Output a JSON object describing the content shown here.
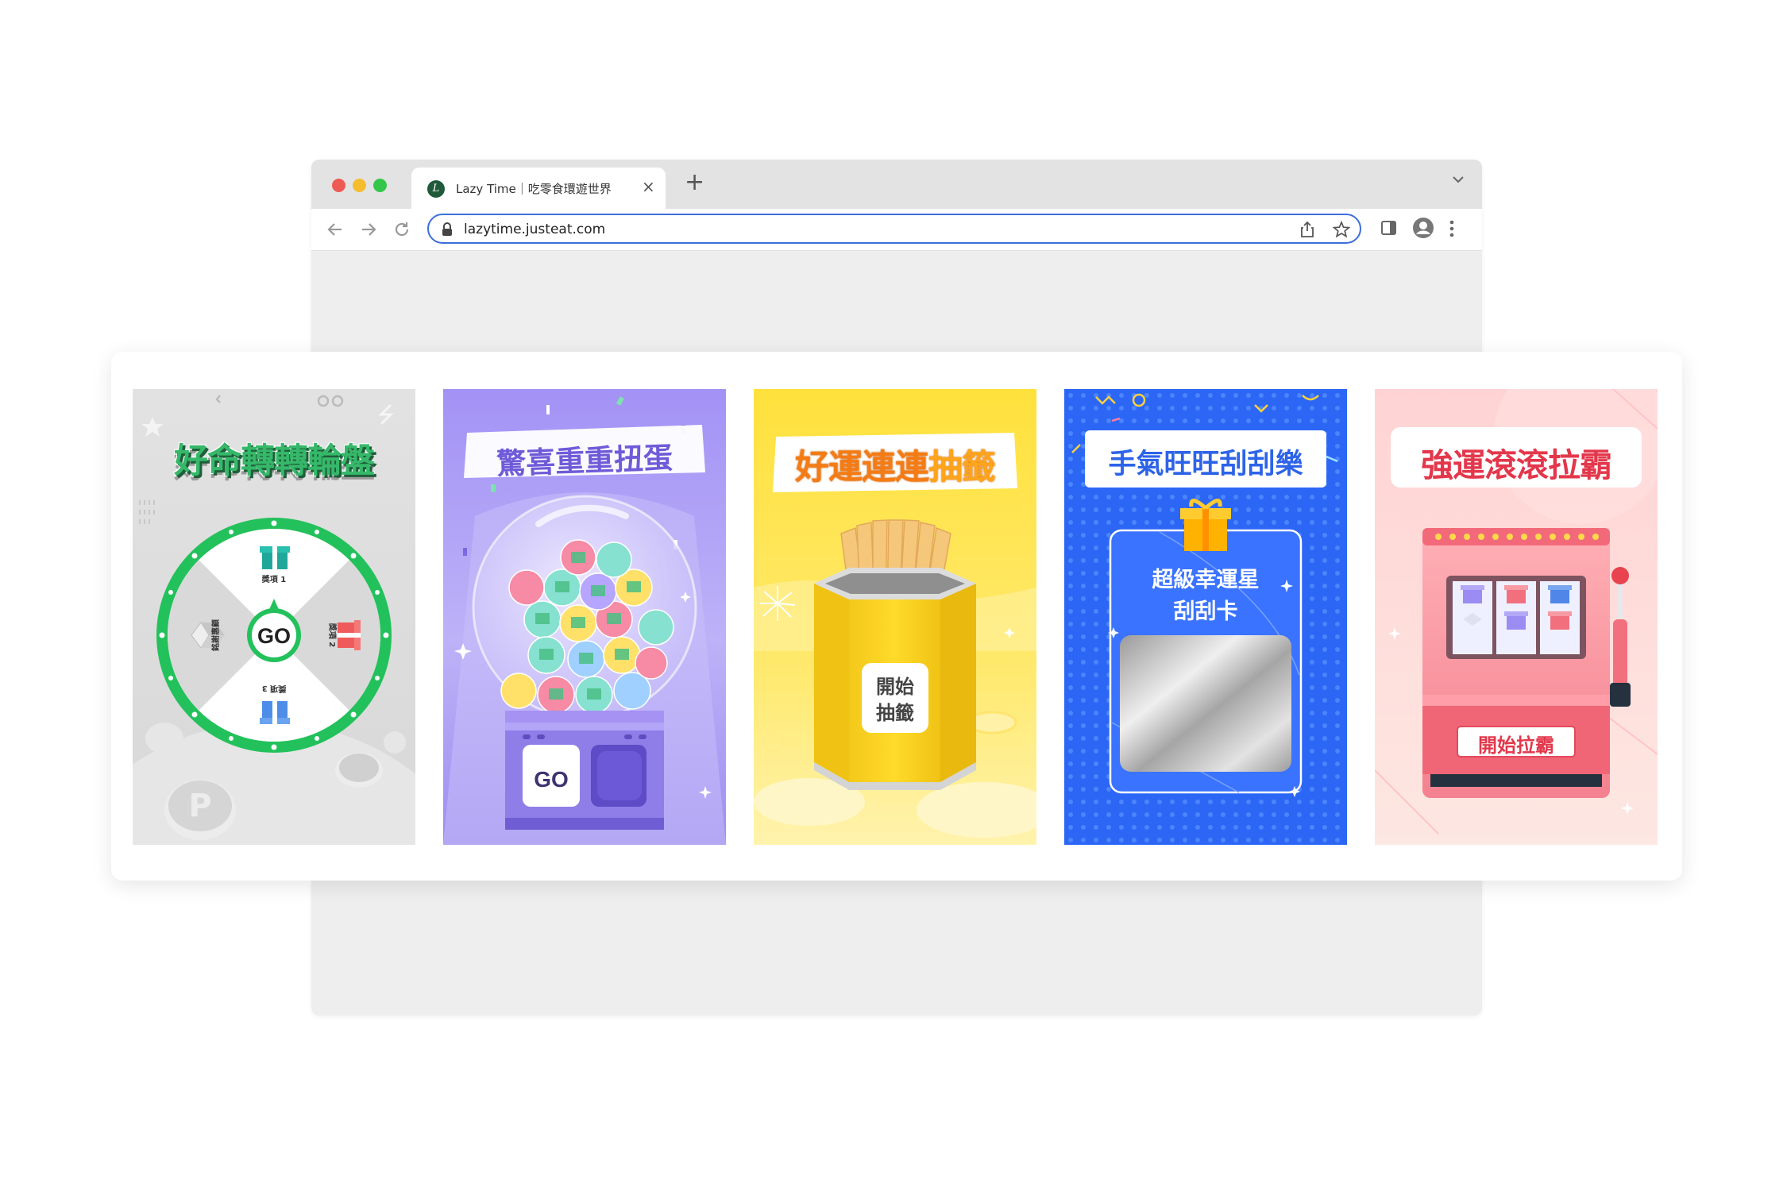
{
  "browser": {
    "tab": {
      "title": "Lazy Time｜吃零食環遊世界",
      "favicon": "L"
    },
    "address": "lazytime.justeat.com"
  },
  "cards": [
    {
      "title": "好命轉轉輪盤",
      "center": "GO",
      "segments": [
        "獎項 1",
        "獎項 2",
        "獎項 3",
        "銘謝惠顧"
      ]
    },
    {
      "title": "驚喜重重扭蛋",
      "button": "GO"
    },
    {
      "title_a": "好運連連",
      "title_b": "抽籤",
      "button_line1": "開始",
      "button_line2": "抽籤"
    },
    {
      "title": "手氣旺旺刮刮樂",
      "line1": "超級幸運星",
      "line2": "刮刮卡"
    },
    {
      "title": "強運滾滾拉霸",
      "button": "開始拉霸"
    }
  ],
  "colors": {
    "wheel_green": "#23c15b",
    "gacha_purple": "#9f8ff2",
    "lot_yellow": "#ffe23c",
    "scratch_blue": "#2b6bff",
    "slot_pink": "#f45f6f"
  }
}
